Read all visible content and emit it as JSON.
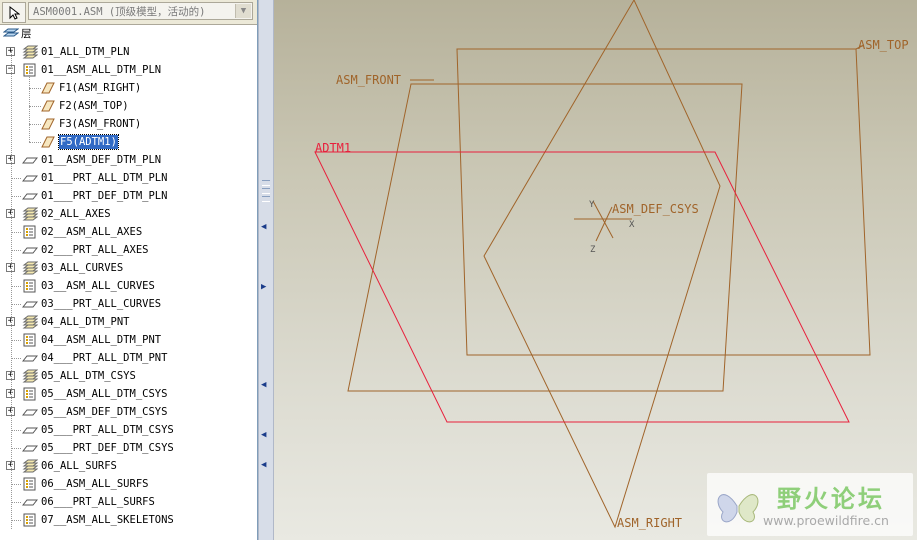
{
  "toolbar": {
    "model_name": "ASM0001.ASM (顶级模型，活动的)"
  },
  "tree": {
    "root_label": "层",
    "items": [
      {
        "label": "01_ALL_DTM_PLN",
        "level": 0,
        "icon": "layer-stack-icon",
        "expander": "+"
      },
      {
        "label": "01__ASM_ALL_DTM_PLN",
        "level": 0,
        "icon": "rule-layer-icon",
        "expander": "-"
      },
      {
        "label": "F1(ASM_RIGHT)",
        "level": 1,
        "icon": "datum-plane-icon"
      },
      {
        "label": "F2(ASM_TOP)",
        "level": 1,
        "icon": "datum-plane-icon"
      },
      {
        "label": "F3(ASM_FRONT)",
        "level": 1,
        "icon": "datum-plane-icon"
      },
      {
        "label": "F5(ADTM1)",
        "level": 1,
        "icon": "datum-plane-icon",
        "selected": true
      },
      {
        "label": "01__ASM_DEF_DTM_PLN",
        "level": 0,
        "icon": "plane-layer-icon",
        "expander": "+"
      },
      {
        "label": "01___PRT_ALL_DTM_PLN",
        "level": 0,
        "icon": "plane-layer-icon"
      },
      {
        "label": "01___PRT_DEF_DTM_PLN",
        "level": 0,
        "icon": "plane-layer-icon"
      },
      {
        "label": "02_ALL_AXES",
        "level": 0,
        "icon": "layer-stack-icon",
        "expander": "+"
      },
      {
        "label": "02__ASM_ALL_AXES",
        "level": 0,
        "icon": "rule-layer-icon"
      },
      {
        "label": "02___PRT_ALL_AXES",
        "level": 0,
        "icon": "plane-layer-icon"
      },
      {
        "label": "03_ALL_CURVES",
        "level": 0,
        "icon": "layer-stack-icon",
        "expander": "+"
      },
      {
        "label": "03__ASM_ALL_CURVES",
        "level": 0,
        "icon": "rule-layer-icon"
      },
      {
        "label": "03___PRT_ALL_CURVES",
        "level": 0,
        "icon": "plane-layer-icon"
      },
      {
        "label": "04_ALL_DTM_PNT",
        "level": 0,
        "icon": "layer-stack-icon",
        "expander": "+"
      },
      {
        "label": "04__ASM_ALL_DTM_PNT",
        "level": 0,
        "icon": "rule-layer-icon"
      },
      {
        "label": "04___PRT_ALL_DTM_PNT",
        "level": 0,
        "icon": "plane-layer-icon"
      },
      {
        "label": "05_ALL_DTM_CSYS",
        "level": 0,
        "icon": "layer-stack-icon",
        "expander": "+"
      },
      {
        "label": "05__ASM_ALL_DTM_CSYS",
        "level": 0,
        "icon": "rule-layer-icon",
        "expander": "+"
      },
      {
        "label": "05__ASM_DEF_DTM_CSYS",
        "level": 0,
        "icon": "plane-layer-icon",
        "expander": "+"
      },
      {
        "label": "05___PRT_ALL_DTM_CSYS",
        "level": 0,
        "icon": "plane-layer-icon"
      },
      {
        "label": "05___PRT_DEF_DTM_CSYS",
        "level": 0,
        "icon": "plane-layer-icon"
      },
      {
        "label": "06_ALL_SURFS",
        "level": 0,
        "icon": "layer-stack-icon",
        "expander": "+"
      },
      {
        "label": "06__ASM_ALL_SURFS",
        "level": 0,
        "icon": "rule-layer-icon"
      },
      {
        "label": "06___PRT_ALL_SURFS",
        "level": 0,
        "icon": "plane-layer-icon"
      },
      {
        "label": "07__ASM_ALL_SKELETONS",
        "level": 0,
        "icon": "rule-layer-icon"
      }
    ]
  },
  "viewport": {
    "datum_labels": {
      "asm_top": "ASM_TOP",
      "asm_front": "ASM_FRONT",
      "adtm1": "ADTM1",
      "asm_def_csys": "ASM_DEF_CSYS",
      "asm_right": "ASM_RIGHT",
      "csys_x": "X",
      "csys_y": "Y",
      "csys_z": "Z"
    },
    "colors": {
      "datum": "#a0642a",
      "selected_datum": "#e8203c"
    }
  },
  "watermark": {
    "title": "野火论坛",
    "url": "www.proewildfire.cn"
  }
}
